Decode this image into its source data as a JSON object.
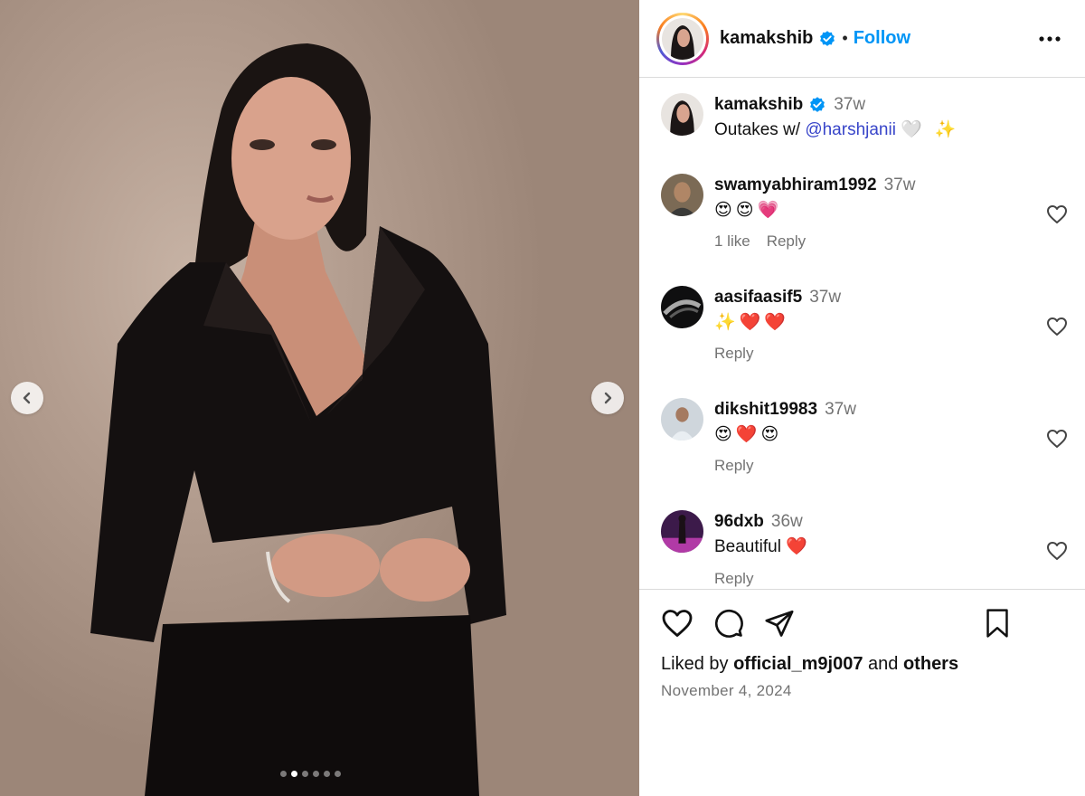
{
  "post": {
    "author": "kamakshib",
    "follow_label": "Follow",
    "separator": "•",
    "caption": {
      "username": "kamakshib",
      "time": "37w",
      "text_prefix": "Outakes w/ ",
      "mention": "@harshjanii",
      "emojis": "🤍 ✨"
    },
    "carousel": {
      "count": 6,
      "active_index": 1
    }
  },
  "comments": [
    {
      "username": "swamyabhiram1992",
      "time": "37w",
      "text": "😍😍💗",
      "likes": "1 like",
      "reply": "Reply"
    },
    {
      "username": "aasifaasif5",
      "time": "37w",
      "text": "✨❤️❤️",
      "reply": "Reply"
    },
    {
      "username": "dikshit19983",
      "time": "37w",
      "text": "😍❤️😍",
      "reply": "Reply"
    },
    {
      "username": "96dxb",
      "time": "36w",
      "text": "Beautiful ❤️",
      "reply": "Reply"
    }
  ],
  "footer": {
    "liked_by_prefix": "Liked by ",
    "liked_by_user": "official_m9j007",
    "liked_by_and": " and ",
    "liked_by_others": "others",
    "date": "November 4, 2024"
  },
  "colors": {
    "accent": "#0095f6",
    "mention": "#3845c9",
    "verified": "#0095f6",
    "muted": "#737373"
  },
  "icons": [
    "chevron-left-icon",
    "chevron-right-icon",
    "verified-badge-icon",
    "more-icon",
    "heart-icon",
    "comment-icon",
    "share-icon",
    "bookmark-icon"
  ]
}
